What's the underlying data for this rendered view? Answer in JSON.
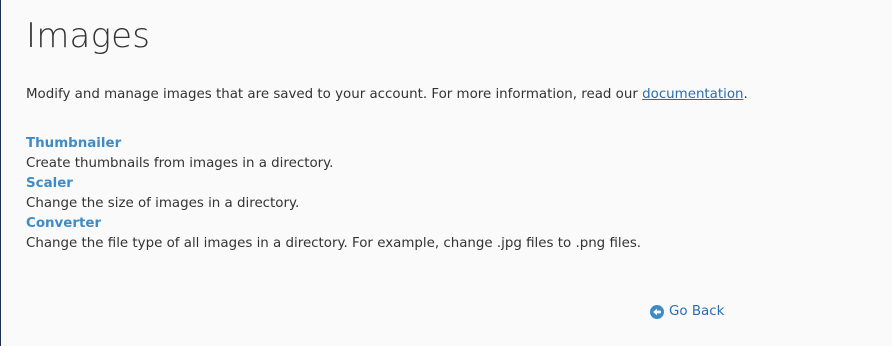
{
  "page": {
    "title": "Images",
    "description_text": "Modify and manage images that are saved to your account. For more information, read our ",
    "description_link": "documentation",
    "description_end": "."
  },
  "tools": [
    {
      "name": "Thumbnailer",
      "description": "Create thumbnails from images in a directory."
    },
    {
      "name": "Scaler",
      "description": "Change the size of images in a directory."
    },
    {
      "name": "Converter",
      "description": "Change the file type of all images in a directory. For example, change .jpg files to .png files."
    }
  ],
  "footer": {
    "go_back_label": "Go Back",
    "go_back_icon": "arrow-circle-left-icon"
  },
  "colors": {
    "link": "#2a6db0",
    "tool_link": "#3d8cc7",
    "text": "#333333",
    "background": "#fafafa"
  }
}
